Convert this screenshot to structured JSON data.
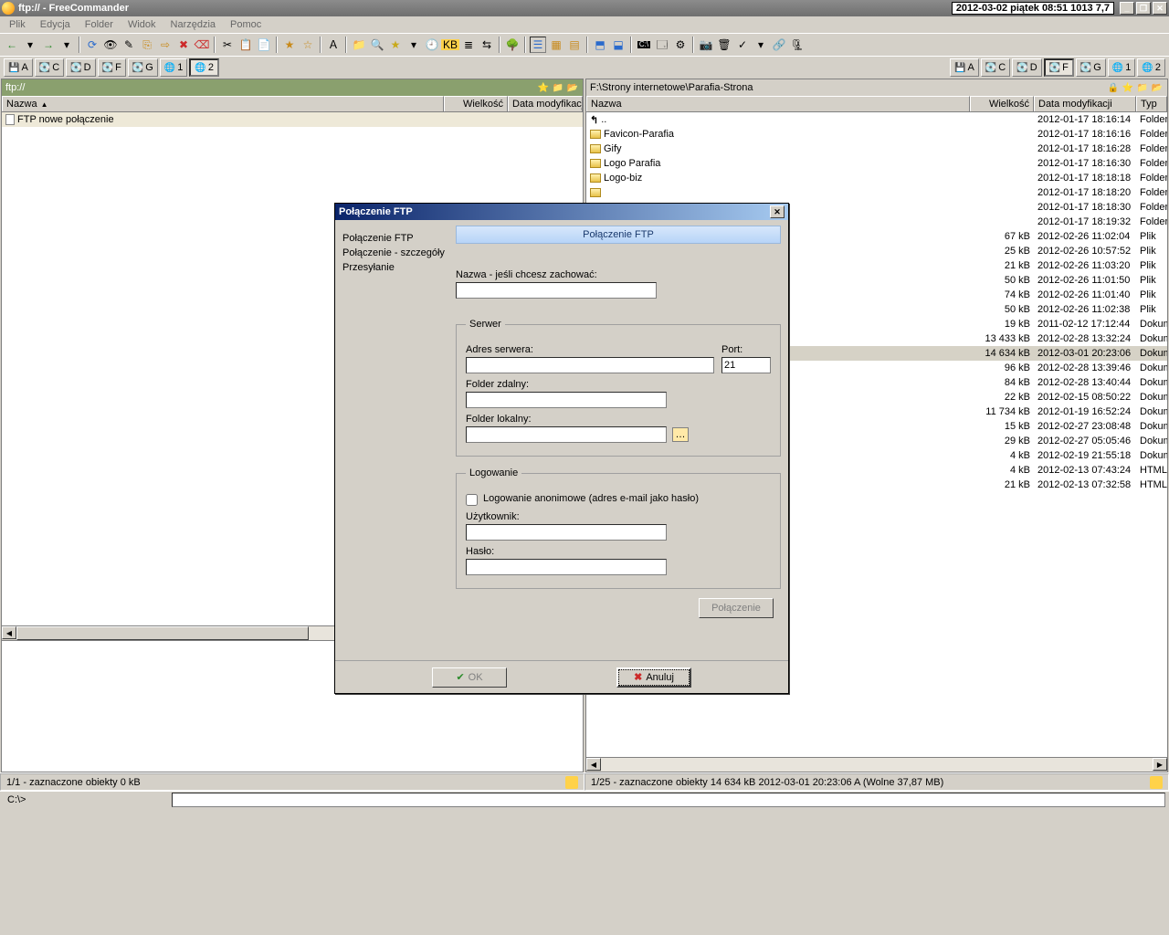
{
  "titlebar": {
    "title": "ftp:// - FreeCommander",
    "clock": "2012-03-02 piątek 08:51  1013  7,7"
  },
  "menu": {
    "items": [
      "Plik",
      "Edycja",
      "Folder",
      "Widok",
      "Narzędzia",
      "Pomoc"
    ]
  },
  "drives_left": [
    "A",
    "C",
    "D",
    "F",
    "G",
    "1",
    "2"
  ],
  "drives_right": [
    "A",
    "C",
    "D",
    "F",
    "G",
    "1",
    "2"
  ],
  "panel_left": {
    "path": "ftp://",
    "cols": {
      "name": "Nazwa",
      "size": "Wielkość",
      "date": "Data modyfikacji"
    },
    "rows": [
      {
        "name": "FTP nowe połączenie",
        "size": "",
        "date": "",
        "icon": "file",
        "sel": true
      }
    ],
    "bottom_blank_rows": 39
  },
  "panel_right": {
    "path": "F:\\Strony internetowe\\Parafia-Strona",
    "cols": {
      "name": "Nazwa",
      "size": "Wielkość",
      "date": "Data modyfikacji",
      "type": "Typ"
    },
    "rows": [
      {
        "name": "..",
        "size": "",
        "date": "2012-01-17 18:16:14",
        "type": "Folder",
        "icon": "up"
      },
      {
        "name": "Favicon-Parafia",
        "size": "",
        "date": "2012-01-17 18:16:16",
        "type": "Folder",
        "icon": "folder"
      },
      {
        "name": "Gify",
        "size": "",
        "date": "2012-01-17 18:16:28",
        "type": "Folder",
        "icon": "folder"
      },
      {
        "name": "Logo Parafia",
        "size": "",
        "date": "2012-01-17 18:16:30",
        "type": "Folder",
        "icon": "folder"
      },
      {
        "name": "Logo-biz",
        "size": "",
        "date": "2012-01-17 18:18:18",
        "type": "Folder",
        "icon": "folder"
      },
      {
        "name": "",
        "size": "",
        "date": "2012-01-17 18:18:20",
        "type": "Folder",
        "icon": "folder"
      },
      {
        "name": "",
        "size": "",
        "date": "2012-01-17 18:18:30",
        "type": "Folder",
        "icon": "folder"
      },
      {
        "name": "",
        "size": "",
        "date": "2012-01-17 18:19:32",
        "type": "Folder",
        "icon": "folder"
      },
      {
        "name": "",
        "size": "67 kB",
        "date": "2012-02-26 11:02:04",
        "type": "Plik",
        "icon": "file"
      },
      {
        "name": "",
        "size": "25 kB",
        "date": "2012-02-26 10:57:52",
        "type": "Plik",
        "icon": "file"
      },
      {
        "name": "",
        "size": "21 kB",
        "date": "2012-02-26 11:03:20",
        "type": "Plik",
        "icon": "file"
      },
      {
        "name": "",
        "size": "50 kB",
        "date": "2012-02-26 11:01:50",
        "type": "Plik",
        "icon": "file"
      },
      {
        "name": "",
        "size": "74 kB",
        "date": "2012-02-26 11:01:40",
        "type": "Plik",
        "icon": "file"
      },
      {
        "name": "",
        "size": "50 kB",
        "date": "2012-02-26 11:02:38",
        "type": "Plik",
        "icon": "file"
      },
      {
        "name": "",
        "size": "19 kB",
        "date": "2011-02-12 17:12:44",
        "type": "Dokume",
        "icon": "file"
      },
      {
        "name": "",
        "size": "13 433 kB",
        "date": "2012-02-28 13:32:24",
        "type": "Dokume",
        "icon": "file"
      },
      {
        "name": "",
        "size": "14 634 kB",
        "date": "2012-03-01 20:23:06",
        "type": "Dokume",
        "icon": "file",
        "sel": true
      },
      {
        "name": "",
        "size": "96 kB",
        "date": "2012-02-28 13:39:46",
        "type": "Dokume",
        "icon": "file"
      },
      {
        "name": "",
        "size": "84 kB",
        "date": "2012-02-28 13:40:44",
        "type": "Dokume",
        "icon": "file"
      },
      {
        "name": "",
        "size": "22 kB",
        "date": "2012-02-15 08:50:22",
        "type": "Dokume",
        "icon": "file"
      },
      {
        "name": "",
        "size": "11 734 kB",
        "date": "2012-01-19 16:52:24",
        "type": "Dokume",
        "icon": "file"
      },
      {
        "name": "",
        "size": "15 kB",
        "date": "2012-02-27 23:08:48",
        "type": "Dokume",
        "icon": "file"
      },
      {
        "name": "",
        "size": "29 kB",
        "date": "2012-02-27 05:05:46",
        "type": "Dokume",
        "icon": "file"
      },
      {
        "name": "",
        "size": "4 kB",
        "date": "2012-02-19 21:55:18",
        "type": "Dokume",
        "icon": "file"
      },
      {
        "name": "",
        "size": "4 kB",
        "date": "2012-02-13 07:43:24",
        "type": "HTML D",
        "icon": "file"
      },
      {
        "name": "",
        "size": "21 kB",
        "date": "2012-02-13 07:32:58",
        "type": "HTML D",
        "icon": "file"
      }
    ]
  },
  "status_left": "1/1 - zaznaczone obiekty  0 kB",
  "status_right": "1/25 - zaznaczone obiekty  14 634 kB  2012-03-01 20:23:06  A   (Wolne 37,87 MB)",
  "cmdprompt": "C:\\>",
  "dialog": {
    "title": "Połączenie FTP",
    "nav": [
      "Połączenie FTP",
      "Połączenie - szczegóły",
      "Przesyłanie"
    ],
    "panel_title": "Połączenie FTP",
    "f_name_label": "Nazwa - jeśli chcesz zachować:",
    "grp_server": "Serwer",
    "f_addr_label": "Adres serwera:",
    "f_port_label": "Port:",
    "f_port_value": "21",
    "f_remote_label": "Folder zdalny:",
    "f_local_label": "Folder lokalny:",
    "grp_login": "Logowanie",
    "f_anon_label": "Logowanie anonimowe (adres e-mail jako hasło)",
    "f_user_label": "Użytkownik:",
    "f_pass_label": "Hasło:",
    "btn_connect": "Połączenie",
    "btn_ok": "OK",
    "btn_cancel": "Anuluj"
  }
}
